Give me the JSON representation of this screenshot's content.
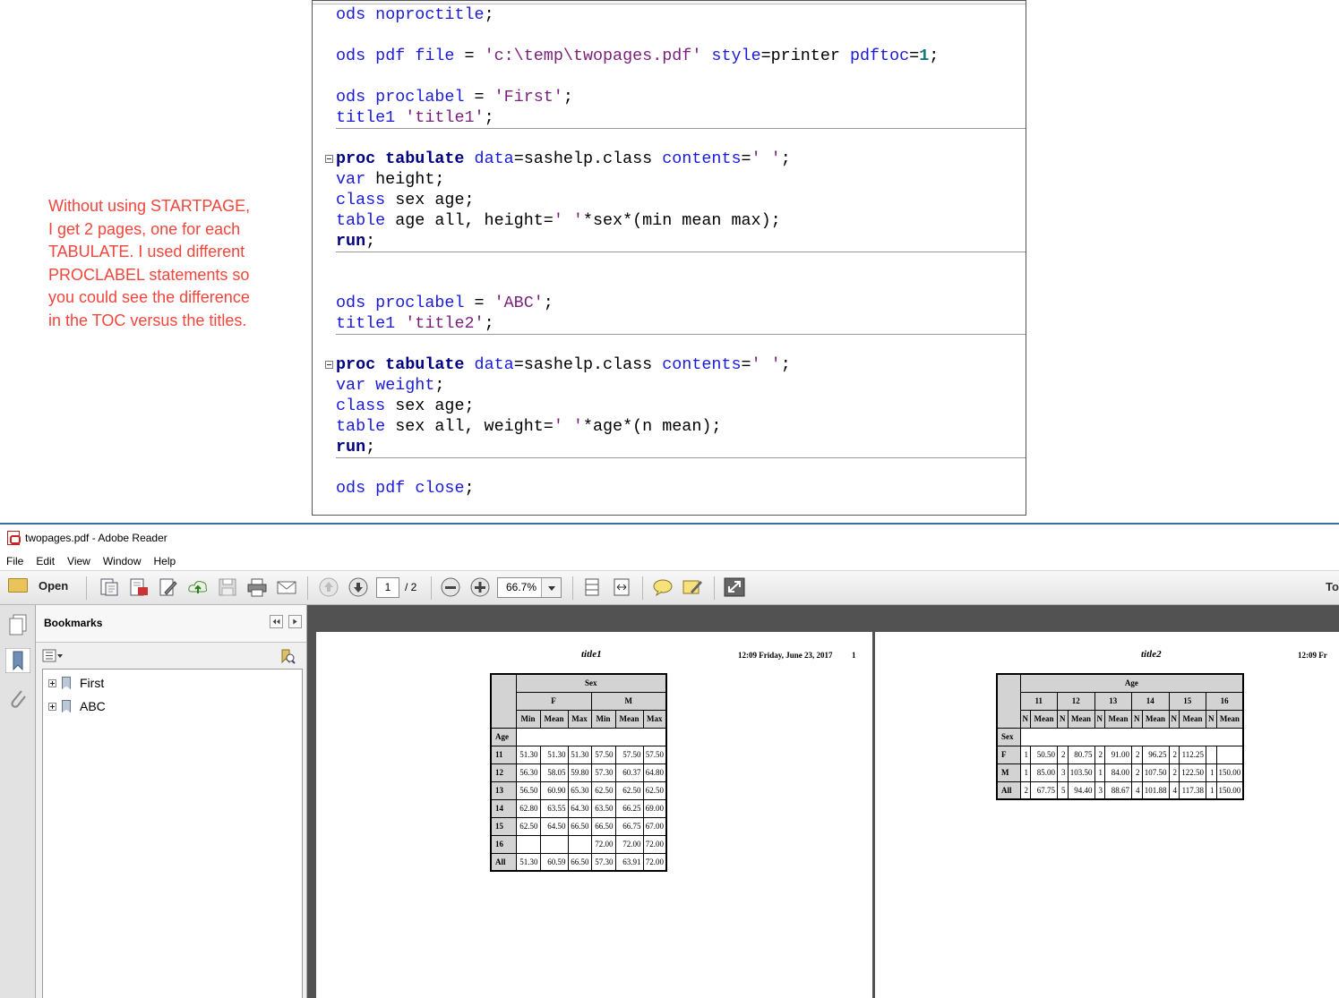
{
  "annotation": {
    "lines": [
      "Without using STARTPAGE,",
      "I get 2 pages, one for each",
      "TABULATE. I used different",
      "PROCLABEL statements so",
      "you could see the difference",
      "in the TOC versus the titles."
    ]
  },
  "code": {
    "l1": [
      "ods",
      " ",
      "noproctitle",
      ";"
    ],
    "l2": [
      "ods",
      " ",
      "pdf",
      " ",
      "file",
      " = ",
      "'c:\\temp\\twopages.pdf'",
      " ",
      "style",
      "=printer ",
      "pdftoc",
      "=",
      "1",
      ";"
    ],
    "l3": [
      "ods",
      " ",
      "proclabel",
      " = ",
      "'First'",
      ";"
    ],
    "l4": [
      "title1",
      " ",
      "'title1'",
      ";"
    ],
    "l5": [
      "proc tabulate",
      " ",
      "data",
      "=sashelp.class ",
      "contents",
      "=",
      "' '",
      ";"
    ],
    "l6": [
      "var",
      " height;"
    ],
    "l7": [
      "class",
      " sex age;"
    ],
    "l8": [
      "table",
      " age all, height=",
      "' '",
      "*sex*(min mean max);"
    ],
    "l9": [
      "run",
      ";"
    ],
    "l10": [
      "ods",
      " ",
      "proclabel",
      " = ",
      "'ABC'",
      ";"
    ],
    "l11": [
      "title1",
      " ",
      "'title2'",
      ";"
    ],
    "l12": [
      "proc tabulate",
      " ",
      "data",
      "=sashelp.class ",
      "contents",
      "=",
      "' '",
      ";"
    ],
    "l13": [
      "var",
      " ",
      "weight",
      ";"
    ],
    "l14": [
      "class",
      " sex age;"
    ],
    "l15": [
      "table",
      " sex all, weight=",
      "' '",
      "*age*(n mean);"
    ],
    "l16": [
      "run",
      ";"
    ],
    "l17": [
      "ods",
      " ",
      "pdf",
      " ",
      "close",
      ";"
    ]
  },
  "reader": {
    "title": "twopages.pdf - Adobe Reader",
    "menu": [
      "File",
      "Edit",
      "View",
      "Window",
      "Help"
    ],
    "toolbar": {
      "open_label": "Open",
      "page_current": "1",
      "page_total": "/ 2",
      "zoom": "66.7%",
      "tools_label": "To"
    },
    "bookmarks": {
      "header": "Bookmarks",
      "items": [
        "First",
        "ABC"
      ]
    },
    "page1": {
      "title": "title1",
      "date": "12:09 Friday, June 23, 2017",
      "page_number": "1",
      "header_top": "Sex",
      "groups": [
        "F",
        "M"
      ],
      "stats": [
        "Min",
        "Mean",
        "Max",
        "Min",
        "Mean",
        "Max"
      ],
      "row_var": "Age",
      "rows": [
        {
          "label": "11",
          "cells": [
            "51.30",
            "51.30",
            "51.30",
            "57.50",
            "57.50",
            "57.50"
          ]
        },
        {
          "label": "12",
          "cells": [
            "56.30",
            "58.05",
            "59.80",
            "57.30",
            "60.37",
            "64.80"
          ]
        },
        {
          "label": "13",
          "cells": [
            "56.50",
            "60.90",
            "65.30",
            "62.50",
            "62.50",
            "62.50"
          ]
        },
        {
          "label": "14",
          "cells": [
            "62.80",
            "63.55",
            "64.30",
            "63.50",
            "66.25",
            "69.00"
          ]
        },
        {
          "label": "15",
          "cells": [
            "62.50",
            "64.50",
            "66.50",
            "66.50",
            "66.75",
            "67.00"
          ]
        },
        {
          "label": "16",
          "cells": [
            "",
            "",
            "",
            "72.00",
            "72.00",
            "72.00"
          ]
        },
        {
          "label": "All",
          "cells": [
            "51.30",
            "60.59",
            "66.50",
            "57.30",
            "63.91",
            "72.00"
          ]
        }
      ]
    },
    "page2": {
      "title": "title2",
      "date": "12:09 Fr",
      "header_top": "Age",
      "groups": [
        "11",
        "12",
        "13",
        "14",
        "15",
        "16"
      ],
      "stats": [
        "N",
        "Mean",
        "N",
        "Mean",
        "N",
        "Mean",
        "N",
        "Mean",
        "N",
        "Mean",
        "N",
        "Mean"
      ],
      "row_var": "Sex",
      "rows": [
        {
          "label": "F",
          "cells": [
            "1",
            "50.50",
            "2",
            "80.75",
            "2",
            "91.00",
            "2",
            "96.25",
            "2",
            "112.25",
            "",
            ""
          ]
        },
        {
          "label": "M",
          "cells": [
            "1",
            "85.00",
            "3",
            "103.50",
            "1",
            "84.00",
            "2",
            "107.50",
            "2",
            "122.50",
            "1",
            "150.00"
          ]
        },
        {
          "label": "All",
          "cells": [
            "2",
            "67.75",
            "5",
            "94.40",
            "3",
            "88.67",
            "4",
            "101.88",
            "4",
            "117.38",
            "1",
            "150.00"
          ]
        }
      ]
    }
  }
}
